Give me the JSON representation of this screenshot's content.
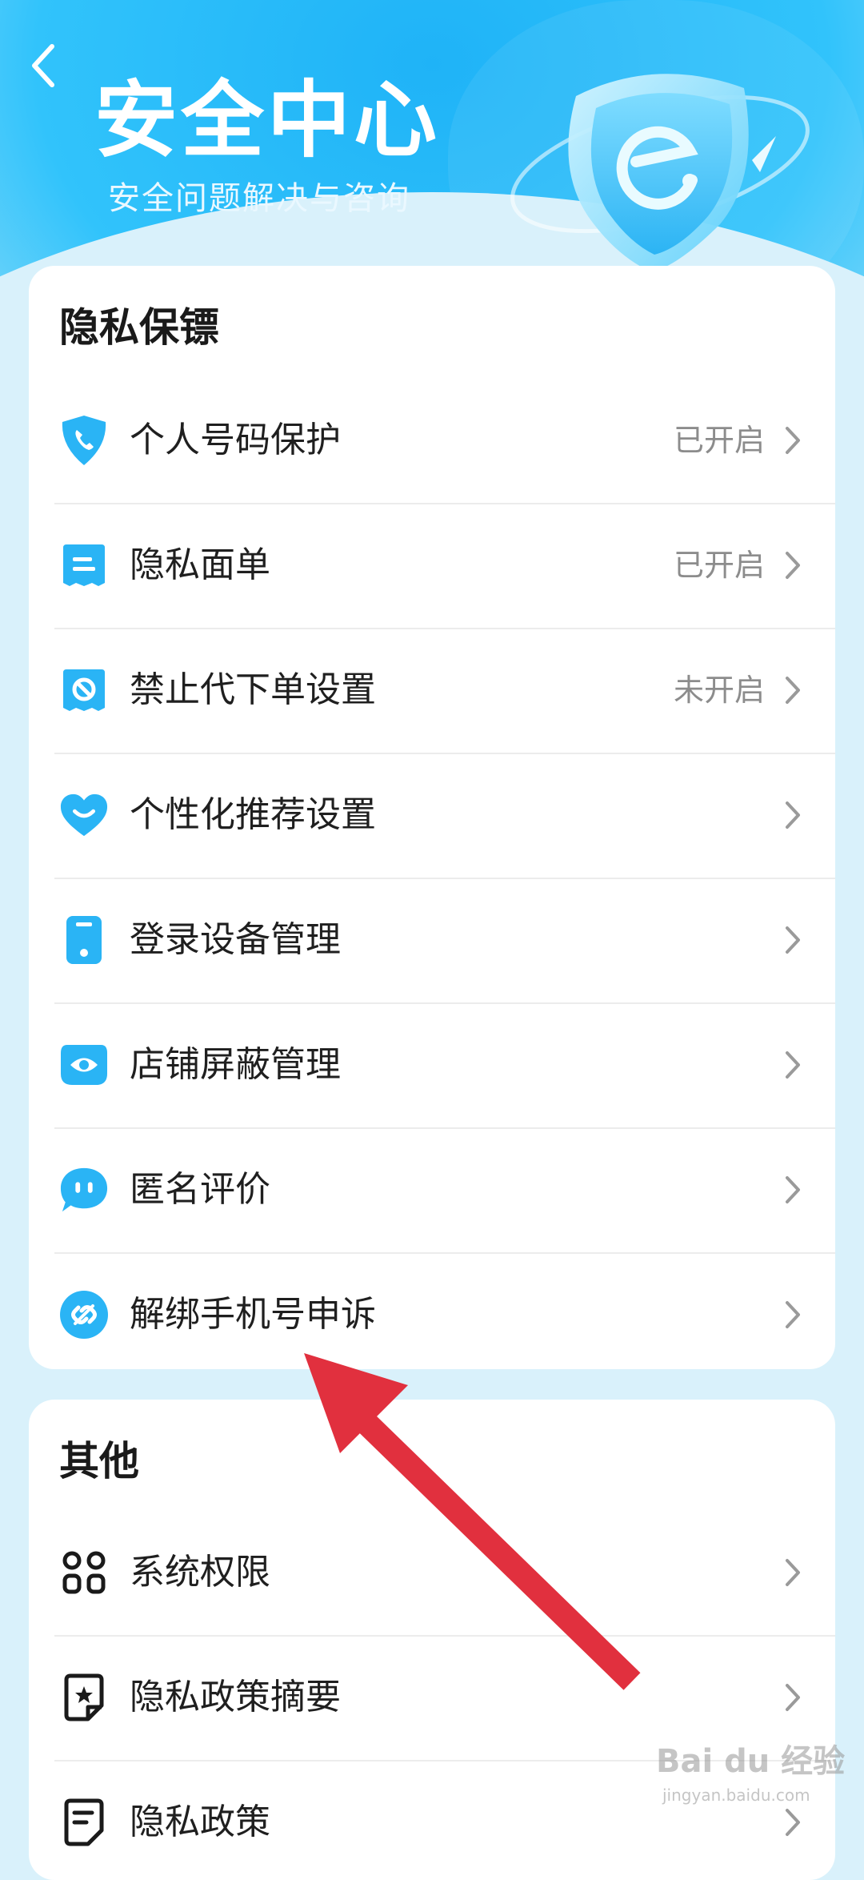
{
  "header": {
    "title": "安全中心",
    "subtitle": "安全问题解决与咨询"
  },
  "privacy_section": {
    "title": "隐私保镖",
    "items": [
      {
        "label": "个人号码保护",
        "status": "已开启",
        "icon": "phone-shield-icon"
      },
      {
        "label": "隐私面单",
        "status": "已开启",
        "icon": "receipt-icon"
      },
      {
        "label": "禁止代下单设置",
        "status": "未开启",
        "icon": "prohibit-icon"
      },
      {
        "label": "个性化推荐设置",
        "status": "",
        "icon": "heart-smile-icon"
      },
      {
        "label": "登录设备管理",
        "status": "",
        "icon": "phone-device-icon"
      },
      {
        "label": "店铺屏蔽管理",
        "status": "",
        "icon": "eye-icon"
      },
      {
        "label": "匿名评价",
        "status": "",
        "icon": "chat-bubble-icon"
      },
      {
        "label": "解绑手机号申诉",
        "status": "",
        "icon": "unlink-icon"
      }
    ]
  },
  "other_section": {
    "title": "其他",
    "items": [
      {
        "label": "系统权限",
        "icon": "grid-permissions-icon"
      },
      {
        "label": "隐私政策摘要",
        "icon": "document-star-icon"
      },
      {
        "label": "隐私政策",
        "icon": "document-icon"
      }
    ]
  },
  "watermark": {
    "text": "Bai du 经验",
    "sub": "jingyan.baidu.com"
  },
  "colors": {
    "accent": "#2bb6f5",
    "arrow": "#e1303e",
    "status_text": "#8c8c8c"
  }
}
